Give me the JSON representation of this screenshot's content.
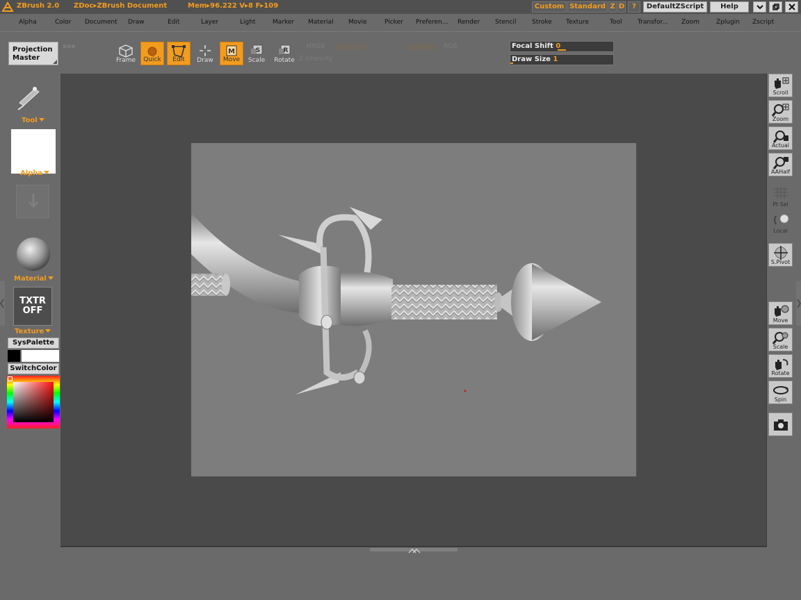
{
  "titlebar": {
    "app": "ZBrush 2.0",
    "doc": "ZDoc▸ZBrush Document",
    "mem": "Mem▸96.222 V▸8 F▸109",
    "buttons": [
      "Custom",
      "Standard",
      "Z",
      "D",
      "?"
    ],
    "script": "DefaultZScript",
    "help": "Help"
  },
  "menus": [
    "Alpha",
    "Color",
    "Document",
    "Draw",
    "Edit",
    "Layer",
    "Light",
    "Marker",
    "Material",
    "Movie",
    "Picker",
    "Preferen...",
    "Render",
    "Stencil",
    "Stroke",
    "Texture",
    "Tool",
    "Transfor...",
    "Zoom",
    "Zplugin",
    "Zscript"
  ],
  "shelf": {
    "projection_master": "Projection Master",
    "buttons": [
      {
        "label": "Frame",
        "icon": "frame-icon",
        "active": false
      },
      {
        "label": "Quick",
        "icon": "quick-icon",
        "active": true
      },
      {
        "label": "Edit",
        "icon": "edit-icon",
        "active": true
      },
      {
        "label": "Draw",
        "icon": "draw-icon",
        "active": false
      },
      {
        "label": "Move",
        "icon": "move-icon",
        "active": true
      },
      {
        "label": "Scale",
        "icon": "scale-icon",
        "active": false
      },
      {
        "label": "Rotate",
        "icon": "rotate-icon",
        "active": false
      }
    ],
    "ghost": {
      "mrgb": "MRGB",
      "rgb": "RGB",
      "z_intensity": "Z Intensity"
    },
    "focal_shift": {
      "label": "Focal Shift",
      "value": "0"
    },
    "draw_size": {
      "label": "Draw Size",
      "value": "1"
    }
  },
  "left": {
    "tool": "Tool",
    "alpha": "Alpha",
    "material": "Material",
    "texture": "Texture",
    "txtr_off": "TXTR OFF",
    "syspalette": "SysPalette",
    "switchcolor": "SwitchColor"
  },
  "right": {
    "buttons": [
      {
        "label": "Scroll",
        "icon": "scroll-icon"
      },
      {
        "label": "Zoom",
        "icon": "zoom-icon"
      },
      {
        "label": "Actual",
        "icon": "actual-icon"
      },
      {
        "label": "AAHalf",
        "icon": "aahalf-icon"
      },
      {
        "label": "Pt Sel",
        "icon": "pt-sel-icon"
      },
      {
        "label": "Local",
        "icon": "local-icon"
      },
      {
        "label": "S.Pivot",
        "icon": "spivot-icon"
      },
      {
        "label": "Move",
        "icon": "move-hand-icon"
      },
      {
        "label": "Scale",
        "icon": "scale-hand-icon"
      },
      {
        "label": "Rotate",
        "icon": "rotate-hand-icon"
      },
      {
        "label": "Spin",
        "icon": "spin-icon"
      },
      {
        "label": "",
        "icon": "camera-icon"
      }
    ]
  },
  "colors": {
    "accent": "#f29c1f",
    "canvas": "#7d7d7d",
    "viewport": "#4a4a4a"
  }
}
